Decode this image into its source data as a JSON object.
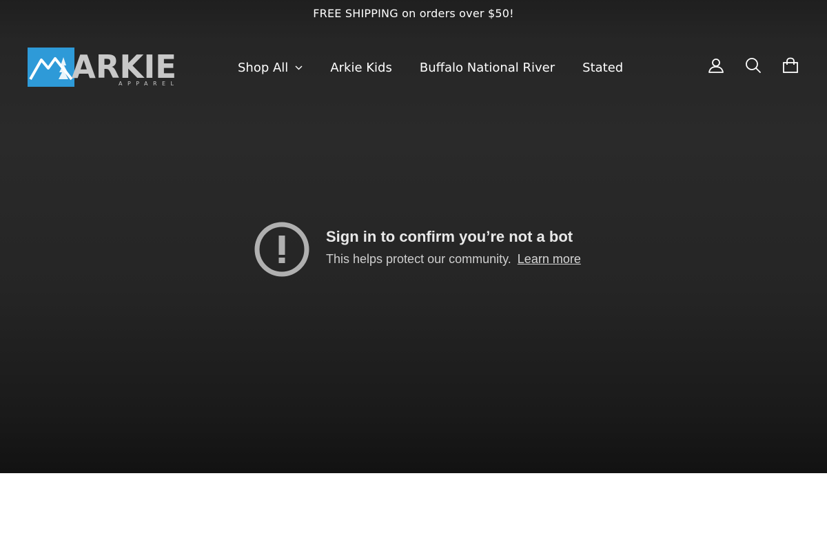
{
  "announcement": {
    "text": "FREE SHIPPING on orders over $50!"
  },
  "logo": {
    "alt": "Arkie Apparel",
    "wordmark": "ARKIE",
    "tagline": "APPAREL",
    "colors": {
      "badge": "#2e9ad8",
      "text": "#c8c8c8"
    }
  },
  "nav": {
    "items": [
      {
        "label": "Shop All",
        "has_dropdown": true
      },
      {
        "label": "Arkie Kids"
      },
      {
        "label": "Buffalo National River"
      },
      {
        "label": "Stated"
      }
    ]
  },
  "header_icons": [
    "account-icon",
    "search-icon",
    "cart-icon"
  ],
  "bot_notice": {
    "title": "Sign in to confirm you’re not a bot",
    "message": "This helps protect our community.",
    "link_label": "Learn more",
    "icon": "alert-circle-icon"
  },
  "colors": {
    "hero_bg": "#262626",
    "text": "#ffffff",
    "icon_gray": "#b0b0b0"
  }
}
